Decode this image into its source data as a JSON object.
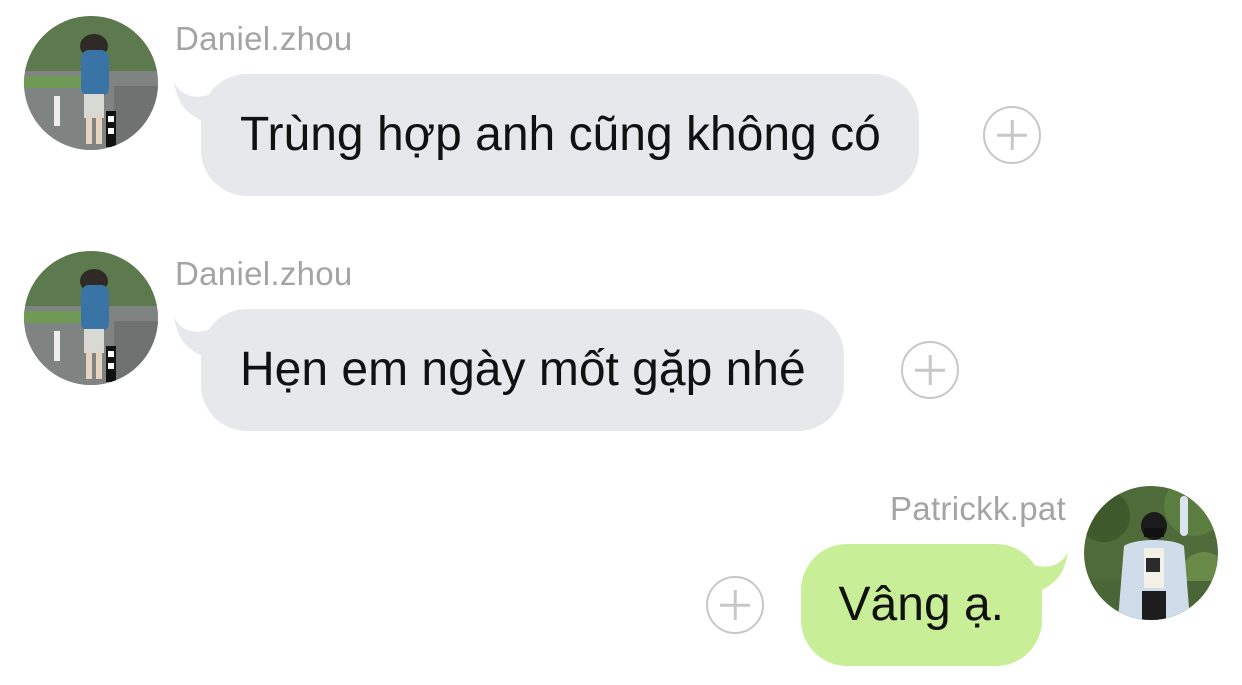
{
  "messages": [
    {
      "direction": "incoming",
      "sender": "Daniel.zhou",
      "text": "Trùng hợp anh cũng không có",
      "bubble_color": "#e7e8ec",
      "react_icon": "add-reaction-icon"
    },
    {
      "direction": "incoming",
      "sender": "Daniel.zhou",
      "text": "Hẹn em ngày mốt gặp nhé",
      "bubble_color": "#e7e8ec",
      "react_icon": "add-reaction-icon"
    },
    {
      "direction": "outgoing",
      "sender": "Patrickk.pat",
      "text": "Vâng ạ.",
      "bubble_color": "#c8ef97",
      "react_icon": "add-reaction-icon"
    }
  ],
  "colors": {
    "incoming_bubble": "#e7e8ec",
    "outgoing_bubble": "#c8ef97",
    "sender_name": "#a4a4a4",
    "react_button": "#c7c7c7"
  }
}
